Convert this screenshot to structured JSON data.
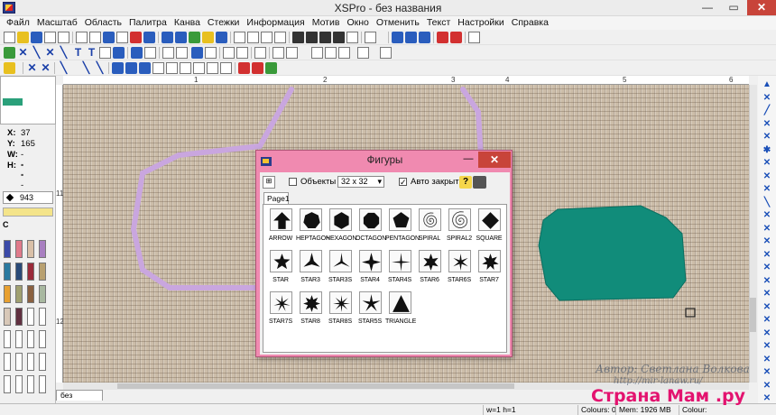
{
  "window": {
    "title": "XSPro - без названия"
  },
  "menu": [
    "Файл",
    "Масштаб",
    "Область",
    "Палитра",
    "Канва",
    "Стежки",
    "Информация",
    "Мотив",
    "Окно",
    "Отменить",
    "Текст",
    "Настройки",
    "Справка"
  ],
  "left_panel": {
    "x_label": "X:",
    "x_value": "37",
    "y_label": "Y:",
    "y_value": "165",
    "w_label": "W:",
    "w_value": "---",
    "h_label": "H:",
    "h_value": "---",
    "color_code": "943",
    "palette_label": "C"
  },
  "ruler": {
    "h_ticks": [
      "1",
      "2",
      "3",
      "4",
      "5",
      "6"
    ],
    "v_ticks": [
      "11",
      "12"
    ]
  },
  "document_tab": "без названия",
  "status": {
    "size": "w=1 h=1",
    "colours": "Colours: 0",
    "memory": "Mem: 1926 MB",
    "colour": "Colour:"
  },
  "dialog": {
    "title": "Фигуры",
    "objects_label": "Объекты",
    "size_select": "32 x 32",
    "auto_close_label": "Авто закрытие",
    "page_tab": "Page1",
    "shapes": [
      {
        "label": "ARROW",
        "icon": "arrow-shape-icon"
      },
      {
        "label": "HEPTAGON",
        "icon": "heptagon-shape-icon"
      },
      {
        "label": "HEXAGON",
        "icon": "hexagon-shape-icon"
      },
      {
        "label": "OCTAGON",
        "icon": "octagon-shape-icon"
      },
      {
        "label": "PENTAGON",
        "icon": "pentagon-shape-icon"
      },
      {
        "label": "SPIRAL",
        "icon": "spiral-shape-icon"
      },
      {
        "label": "SPIRAL2",
        "icon": "spiral2-shape-icon"
      },
      {
        "label": "SQUARE",
        "icon": "square-shape-icon"
      },
      {
        "label": "STAR",
        "icon": "star-shape-icon"
      },
      {
        "label": "STAR3",
        "icon": "star3-shape-icon"
      },
      {
        "label": "STAR3S",
        "icon": "star3s-shape-icon"
      },
      {
        "label": "STAR4",
        "icon": "star4-shape-icon"
      },
      {
        "label": "STAR4S",
        "icon": "star4s-shape-icon"
      },
      {
        "label": "STAR6",
        "icon": "star6-shape-icon"
      },
      {
        "label": "STAR6S",
        "icon": "star6s-shape-icon"
      },
      {
        "label": "STAR7",
        "icon": "star7-shape-icon"
      },
      {
        "label": "STAR7S",
        "icon": "star7s-shape-icon"
      },
      {
        "label": "STAR8",
        "icon": "star8-shape-icon"
      },
      {
        "label": "STAR8S",
        "icon": "star8s-shape-icon"
      },
      {
        "label": "STAR5S",
        "icon": "star5s-shape-icon"
      },
      {
        "label": "TRIANGLE",
        "icon": "triangle-shape-icon"
      }
    ]
  },
  "watermark": {
    "author": "Автор: Светлана Волкова",
    "site": "http://mir-lanaw.ru/",
    "brand": "Страна Мам .ру"
  },
  "colors": {
    "stitch_lilac": "#c9a6df",
    "stitch_teal": "#118c7a",
    "dialog_frame": "#f08ab0",
    "fabric": "#ccbda9"
  }
}
